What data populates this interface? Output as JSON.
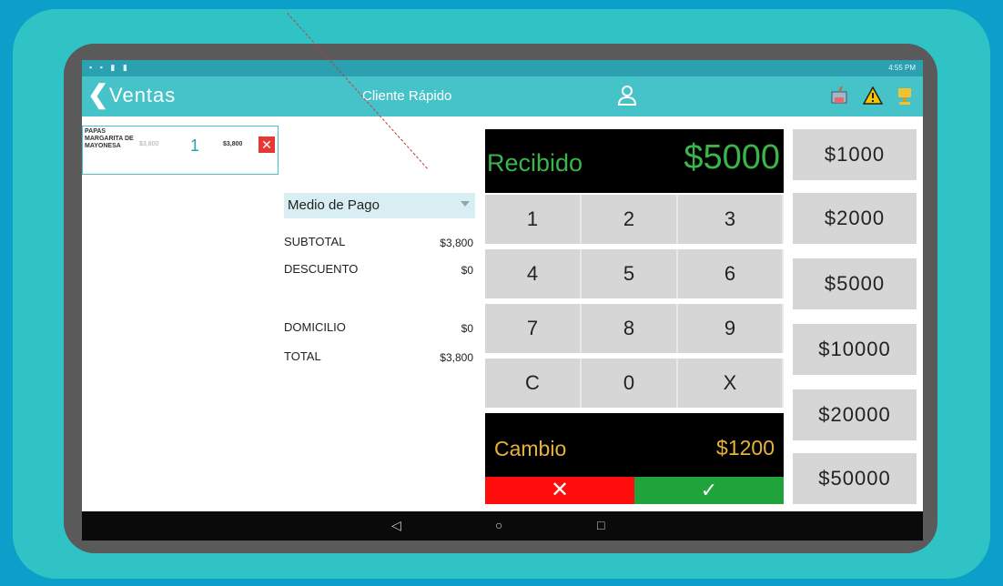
{
  "status_bar": {
    "left_icons": "▪ ▪ ▮ ▮",
    "right_text": "4:55 PM"
  },
  "app_bar": {
    "back_glyph": "❮",
    "title": "Ventas",
    "client": "Cliente Rápido"
  },
  "cart": {
    "items": [
      {
        "name": "PAPAS MARGARITA DE MAYONESA",
        "price": "$3,800",
        "qty": "1",
        "total": "$3,800",
        "delete_glyph": "✕"
      }
    ]
  },
  "payment": {
    "method_label": "Medio de Pago",
    "subtotal_label": "SUBTOTAL",
    "subtotal_value": "$3,800",
    "discount_label": "DESCUENTO",
    "discount_value": "$0",
    "delivery_label": "DOMICILIO",
    "delivery_value": "$0",
    "total_label": "TOTAL",
    "total_value": "$3,800"
  },
  "received": {
    "label": "Recibido",
    "value": "$5000"
  },
  "keypad": [
    "1",
    "2",
    "3",
    "4",
    "5",
    "6",
    "7",
    "8",
    "9",
    "C",
    "0",
    "X"
  ],
  "change": {
    "label": "Cambio",
    "value": "$1200"
  },
  "actions": {
    "cancel_glyph": "✕",
    "confirm_glyph": "✓"
  },
  "quick_amounts": [
    "$1000",
    "$2000",
    "$5000",
    "$10000",
    "$20000",
    "$50000"
  ],
  "navbar": {
    "back": "◁",
    "home": "○",
    "recent": "□"
  },
  "colors": {
    "teal": "#46c2c9",
    "green": "#39b54a",
    "gold": "#e8b23a",
    "red": "#ff0d0d",
    "ok": "#1fa33a"
  }
}
